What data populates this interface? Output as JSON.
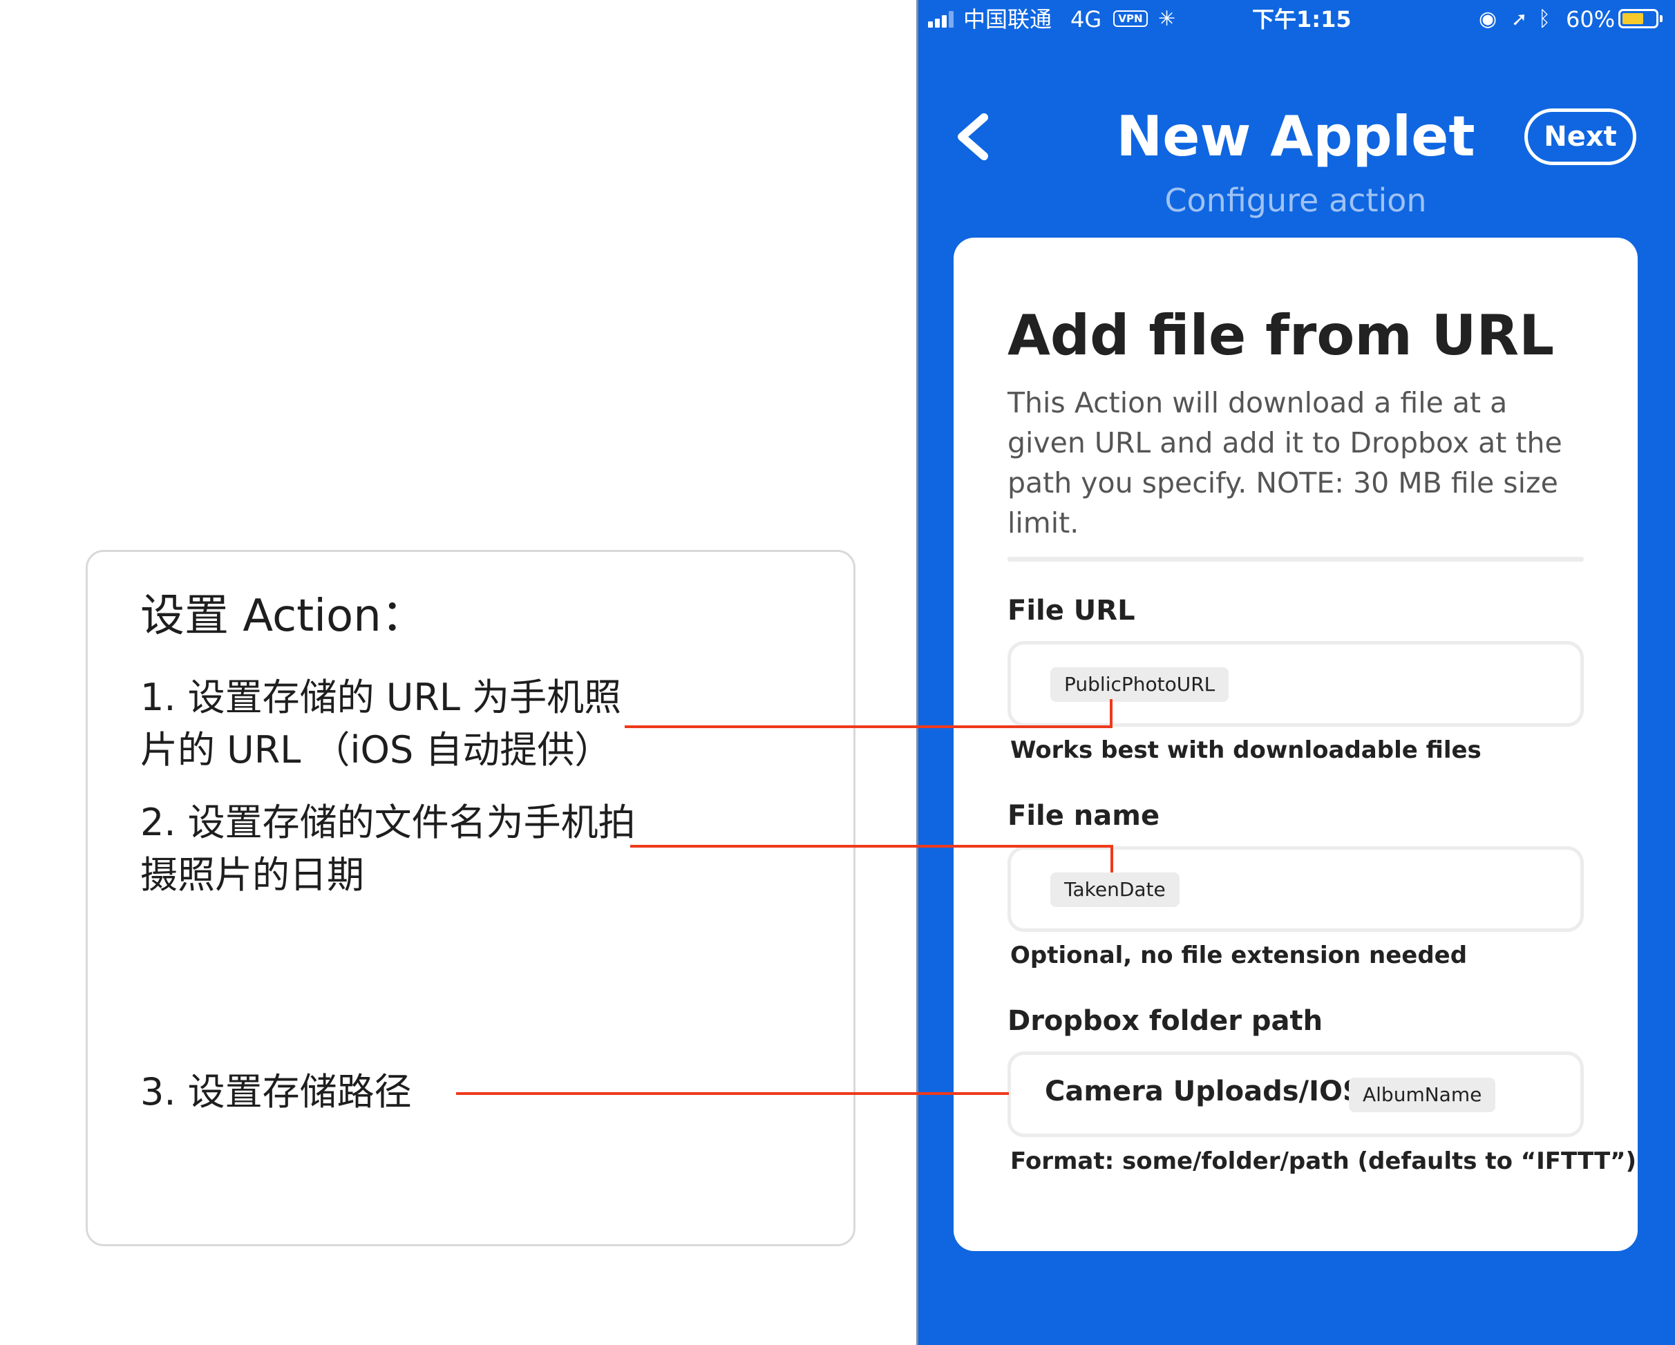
{
  "annotation": {
    "title": "设置 Action：",
    "step1": "1. 设置存储的 URL 为手机照片的 URL （iOS 自动提供）",
    "step2": "2. 设置存储的文件名为手机拍摄照片的日期",
    "step3": "3. 设置存储路径",
    "leader_color": "#ee3a1c"
  },
  "status_bar": {
    "carrier": "中国联通",
    "network": "4G",
    "vpn": "VPN",
    "time": "下午1:15",
    "battery": "60%"
  },
  "nav": {
    "title": "New Applet",
    "subtitle": "Configure action",
    "next_label": "Next"
  },
  "card": {
    "title": "Add file from URL",
    "description": "This Action will download a file at a given URL and add it to Dropbox at the path you specify. NOTE: 30 MB file size limit."
  },
  "fields": {
    "file_url": {
      "label": "File URL",
      "ingredient": "PublicPhotoURL",
      "helper": "Works best with downloadable files"
    },
    "file_name": {
      "label": "File name",
      "ingredient": "TakenDate",
      "helper": "Optional, no file extension needed"
    },
    "folder_path": {
      "label": "Dropbox folder path",
      "text": "Camera Uploads/IOS/",
      "ingredient": "AlbumName",
      "helper": "Format: some/folder/path (defaults to “IFTTT”)"
    }
  },
  "colors": {
    "brand_blue": "#0f66e0",
    "card_bg": "#ffffff",
    "subtitle": "#9fc2f5",
    "battery": "#f7ca2b"
  }
}
